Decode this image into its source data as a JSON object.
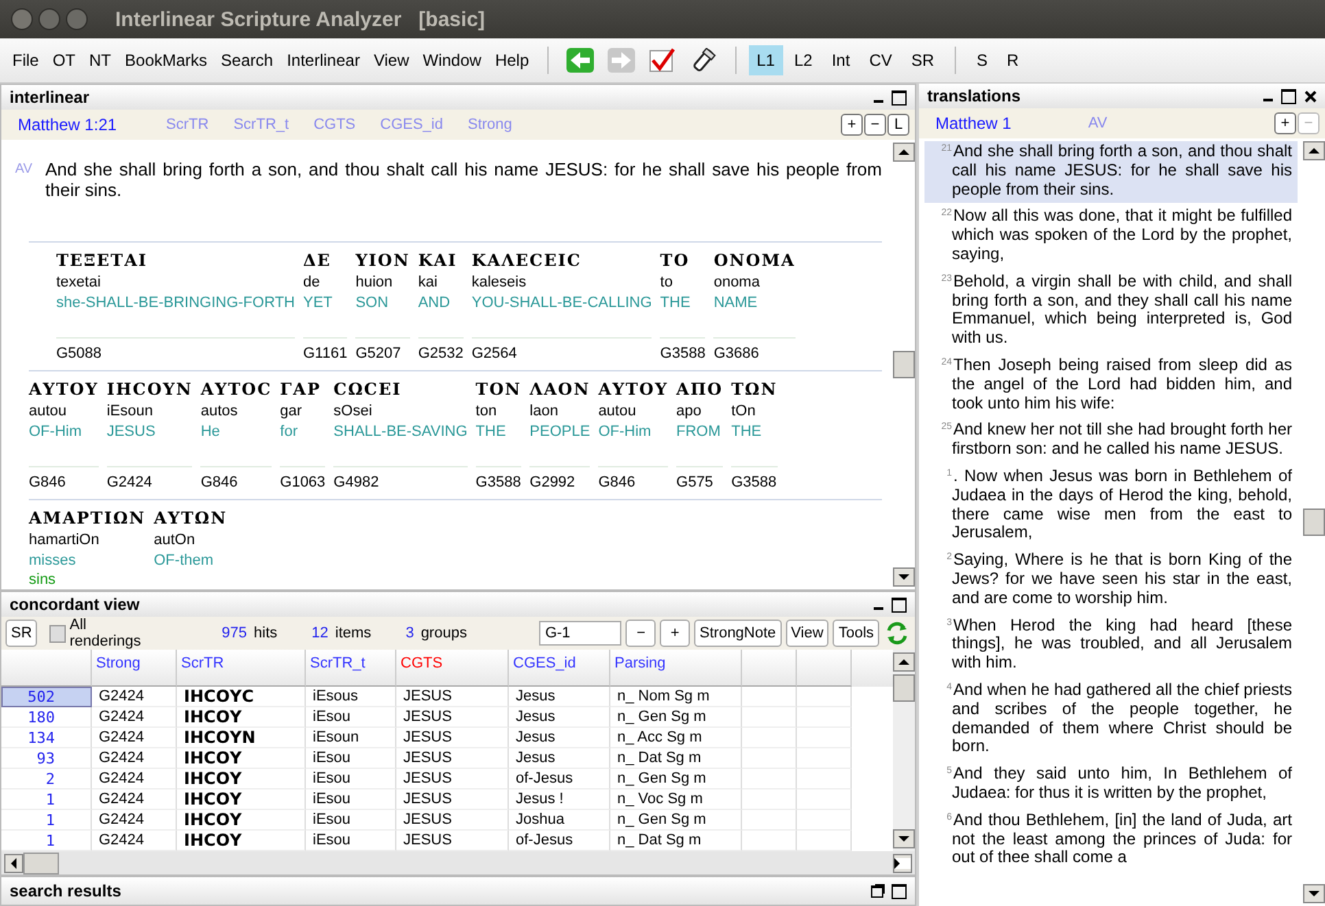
{
  "window": {
    "title": "Interlinear Scripture Analyzer   [basic]"
  },
  "menu": [
    "File",
    "OT",
    "NT",
    "BookMarks",
    "Search",
    "Interlinear",
    "View",
    "Window",
    "Help"
  ],
  "toolbar": [
    {
      "kind": "back",
      "disabled": false
    },
    {
      "kind": "forward",
      "disabled": true
    },
    {
      "kind": "check",
      "disabled": false
    },
    {
      "kind": "flashlight",
      "disabled": false
    },
    {
      "kind": "sep"
    },
    {
      "kind": "text",
      "label": "L1",
      "selected": true
    },
    {
      "kind": "text",
      "label": "L2",
      "selected": false
    },
    {
      "kind": "text",
      "label": "Int",
      "selected": false
    },
    {
      "kind": "text",
      "label": "CV",
      "selected": false
    },
    {
      "kind": "text",
      "label": "SR",
      "selected": false
    },
    {
      "kind": "sep"
    },
    {
      "kind": "text",
      "label": "S",
      "selected": false
    },
    {
      "kind": "text",
      "label": "R",
      "selected": false
    }
  ],
  "interlinear": {
    "title": "interlinear",
    "reference": "Matthew 1:21",
    "versions": [
      "ScrTR",
      "ScrTR_t",
      "CGTS",
      "CGES_id",
      "Strong"
    ],
    "zoom_buttons": [
      "+",
      "−",
      "L"
    ],
    "verse_label": "AV",
    "verse_text": "And she shall bring forth a son, and thou shalt call his name JESUS: for he shall save his people from their sins.",
    "lines": [
      {
        "indent": true,
        "words": [
          {
            "greek": "ΤΕΞΕΤΑΙ",
            "translit": "texetai",
            "glosses": [
              "she-SHALL-BE-BRINGING-FORTH"
            ],
            "strong": "G5088"
          },
          {
            "greek": "ΔΕ",
            "translit": "de",
            "glosses": [
              "YET"
            ],
            "strong": "G1161"
          },
          {
            "greek": "ΥΙΟΝ",
            "translit": "huion",
            "glosses": [
              "SON"
            ],
            "strong": "G5207"
          },
          {
            "greek": "ΚΑΙ",
            "translit": "kai",
            "glosses": [
              "AND"
            ],
            "strong": "G2532"
          },
          {
            "greek": "ΚΑΛΕϹΕΙϹ",
            "translit": "kaleseis",
            "glosses": [
              "YOU-SHALL-BE-CALLING"
            ],
            "strong": "G2564"
          },
          {
            "greek": "ΤΟ",
            "translit": "to",
            "glosses": [
              "THE"
            ],
            "strong": "G3588"
          },
          {
            "greek": "ΟΝΟΜΑ",
            "translit": "onoma",
            "glosses": [
              "NAME"
            ],
            "strong": "G3686"
          }
        ]
      },
      {
        "indent": false,
        "words": [
          {
            "greek": "ΑΥΤΟΥ",
            "translit": "autou",
            "glosses": [
              "OF-Him"
            ],
            "strong": "G846"
          },
          {
            "greek": "ΙΗϹΟΥΝ",
            "translit": "iEsoun",
            "glosses": [
              "JESUS"
            ],
            "strong": "G2424"
          },
          {
            "greek": "ΑΥΤΟϹ",
            "translit": "autos",
            "glosses": [
              "He"
            ],
            "strong": "G846"
          },
          {
            "greek": "ΓΑΡ",
            "translit": "gar",
            "glosses": [
              "for"
            ],
            "strong": "G1063"
          },
          {
            "greek": "ϹΩϹΕΙ",
            "translit": "sOsei",
            "glosses": [
              "SHALL-BE-SAVING"
            ],
            "strong": "G4982"
          },
          {
            "greek": "ΤΟΝ",
            "translit": "ton",
            "glosses": [
              "THE"
            ],
            "strong": "G3588"
          },
          {
            "greek": "ΛΑΟΝ",
            "translit": "laon",
            "glosses": [
              "PEOPLE"
            ],
            "strong": "G2992"
          },
          {
            "greek": "ΑΥΤΟΥ",
            "translit": "autou",
            "glosses": [
              "OF-Him"
            ],
            "strong": "G846"
          },
          {
            "greek": "ΑΠΟ",
            "translit": "apo",
            "glosses": [
              "FROM"
            ],
            "strong": "G575"
          },
          {
            "greek": "ΤΩΝ",
            "translit": "tOn",
            "glosses": [
              "THE"
            ],
            "strong": "G3588"
          }
        ]
      },
      {
        "indent": false,
        "words": [
          {
            "greek": "ΑΜΑΡΤΙΩΝ",
            "translit": "hamartiOn",
            "glosses": [
              "misses",
              "sins"
            ]
          },
          {
            "greek": "ΑΥΤΩΝ",
            "translit": "autOn",
            "glosses": [
              "OF-them"
            ]
          }
        ]
      }
    ]
  },
  "concordant": {
    "title": "concordant view",
    "sr_button": "SR",
    "all_renderings": {
      "label": "All renderings",
      "checked": false
    },
    "stats": [
      {
        "value": "975",
        "label": "hits"
      },
      {
        "value": "12",
        "label": "items"
      },
      {
        "value": "3",
        "label": "groups"
      }
    ],
    "search_value": "G-1",
    "buttons": [
      "−",
      "+",
      "StrongNote",
      "View",
      "Tools"
    ],
    "columns": [
      {
        "label": "Strong",
        "color": "#3333ff"
      },
      {
        "label": "ScrTR",
        "color": "#3333ff"
      },
      {
        "label": "ScrTR_t",
        "color": "#3333ff"
      },
      {
        "label": "CGTS",
        "color": "#ff0000"
      },
      {
        "label": "CGES_id",
        "color": "#3333ff"
      },
      {
        "label": "Parsing",
        "color": "#3333ff"
      }
    ],
    "rows": [
      {
        "count": "502",
        "selected": true,
        "cells": [
          "G2424",
          "ΙΗϹΟΥϹ",
          "iEsous",
          "JESUS",
          "Jesus",
          "n_ Nom Sg m"
        ]
      },
      {
        "count": "180",
        "selected": false,
        "cells": [
          "G2424",
          "ΙΗϹΟΥ",
          "iEsou",
          "JESUS",
          "Jesus",
          "n_ Gen Sg m"
        ]
      },
      {
        "count": "134",
        "selected": false,
        "cells": [
          "G2424",
          "ΙΗϹΟΥΝ",
          "iEsoun",
          "JESUS",
          "Jesus",
          "n_ Acc Sg m"
        ]
      },
      {
        "count": "93",
        "selected": false,
        "cells": [
          "G2424",
          "ΙΗϹΟΥ",
          "iEsou",
          "JESUS",
          "Jesus",
          "n_ Dat Sg m"
        ]
      },
      {
        "count": "2",
        "selected": false,
        "cells": [
          "G2424",
          "ΙΗϹΟΥ",
          "iEsou",
          "JESUS",
          "of-Jesus",
          "n_ Gen Sg m"
        ]
      },
      {
        "count": "1",
        "selected": false,
        "cells": [
          "G2424",
          "ΙΗϹΟΥ",
          "iEsou",
          "JESUS",
          "Jesus !",
          "n_ Voc Sg m"
        ]
      },
      {
        "count": "1",
        "selected": false,
        "cells": [
          "G2424",
          "ΙΗϹΟΥ",
          "iEsou",
          "JESUS",
          "Joshua",
          "n_ Gen Sg m"
        ]
      },
      {
        "count": "1",
        "selected": false,
        "cells": [
          "G2424",
          "ΙΗϹΟΥ",
          "iEsou",
          "JESUS",
          "of-Jesus",
          "n_ Dat Sg m"
        ]
      }
    ]
  },
  "search_results": {
    "title": "search results"
  },
  "translations": {
    "title": "translations",
    "reference": "Matthew 1",
    "version": "AV",
    "zoom_buttons": [
      "+",
      "−"
    ],
    "verses": [
      {
        "number": "21",
        "text": "And she shall bring forth a son, and thou shalt call his name JESUS: for he shall save his people from their sins.",
        "selected": true
      },
      {
        "number": "22",
        "text": "Now all this was done, that it might be fulfilled which was spoken of the Lord by the prophet, saying,",
        "selected": false
      },
      {
        "number": "23",
        "text": "Behold, a virgin shall be with child, and shall bring forth a son, and they shall call his name Emmanuel, which being interpreted is, God with us.",
        "selected": false
      },
      {
        "number": "24",
        "text": "Then Joseph being raised from sleep did as the angel of the Lord had bidden him, and took unto him his wife:",
        "selected": false
      },
      {
        "number": "25",
        "text": "And knew her not till she had brought forth her firstborn son: and he called his name JESUS.",
        "selected": false
      },
      {
        "number": "1",
        "text": ". Now when Jesus was born in Bethlehem of Judaea in the days of Herod the king, behold, there came wise men from the east to Jerusalem,",
        "selected": false
      },
      {
        "number": "2",
        "text": "Saying, Where is he that is born King of the Jews? for we have seen his star in the east, and are come to worship him.",
        "selected": false
      },
      {
        "number": "3",
        "text": "When Herod the king had heard [these things], he was troubled, and all Jerusalem with him.",
        "selected": false
      },
      {
        "number": "4",
        "text": "And when he had gathered all the chief priests and scribes of the people together, he demanded of them where Christ should be born.",
        "selected": false
      },
      {
        "number": "5",
        "text": "And they said unto him, In Bethlehem of Judaea: for thus it is written by the prophet,",
        "selected": false
      },
      {
        "number": "6",
        "text": "And thou Bethlehem, [in] the land of Juda, art not the least among the princes of Juda: for out of thee shall come a",
        "selected": false
      }
    ]
  }
}
